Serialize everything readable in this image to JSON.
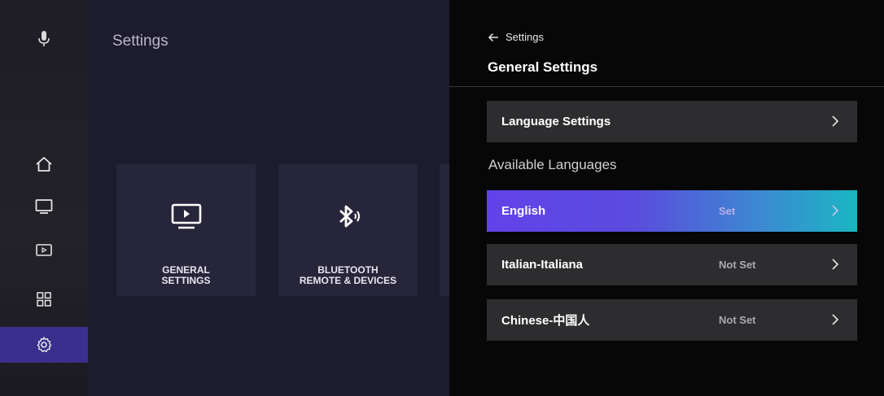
{
  "sidebar": {
    "items": [
      {
        "icon": "mic-icon"
      },
      {
        "icon": "home-icon"
      },
      {
        "icon": "tv-icon"
      },
      {
        "icon": "media-icon"
      },
      {
        "icon": "apps-icon"
      },
      {
        "icon": "gear-icon",
        "active": true
      }
    ]
  },
  "main": {
    "title": "Settings",
    "tiles": [
      {
        "label_line1": "GENERAL",
        "label_line2": "SETTINGS",
        "icon": "tv-play-icon"
      },
      {
        "label_line1": "BLUETOOTH",
        "label_line2": "REMOTE & DEVICES",
        "icon": "bluetooth-icon"
      }
    ]
  },
  "panel": {
    "back_label": "Settings",
    "title": "General Settings",
    "language_settings_label": "Language Settings",
    "section_label": "Available Languages",
    "languages": [
      {
        "name": "English",
        "status": "Set",
        "selected": true
      },
      {
        "name": "Italian-Italiana",
        "status": "Not Set",
        "selected": false
      },
      {
        "name": "Chinese-中国人",
        "status": "Not Set",
        "selected": false
      }
    ]
  },
  "colors": {
    "accent_start": "#6242e9",
    "accent_end": "#1ab6c2",
    "panel_bg": "#070707",
    "row_bg": "#2d2d2f"
  }
}
